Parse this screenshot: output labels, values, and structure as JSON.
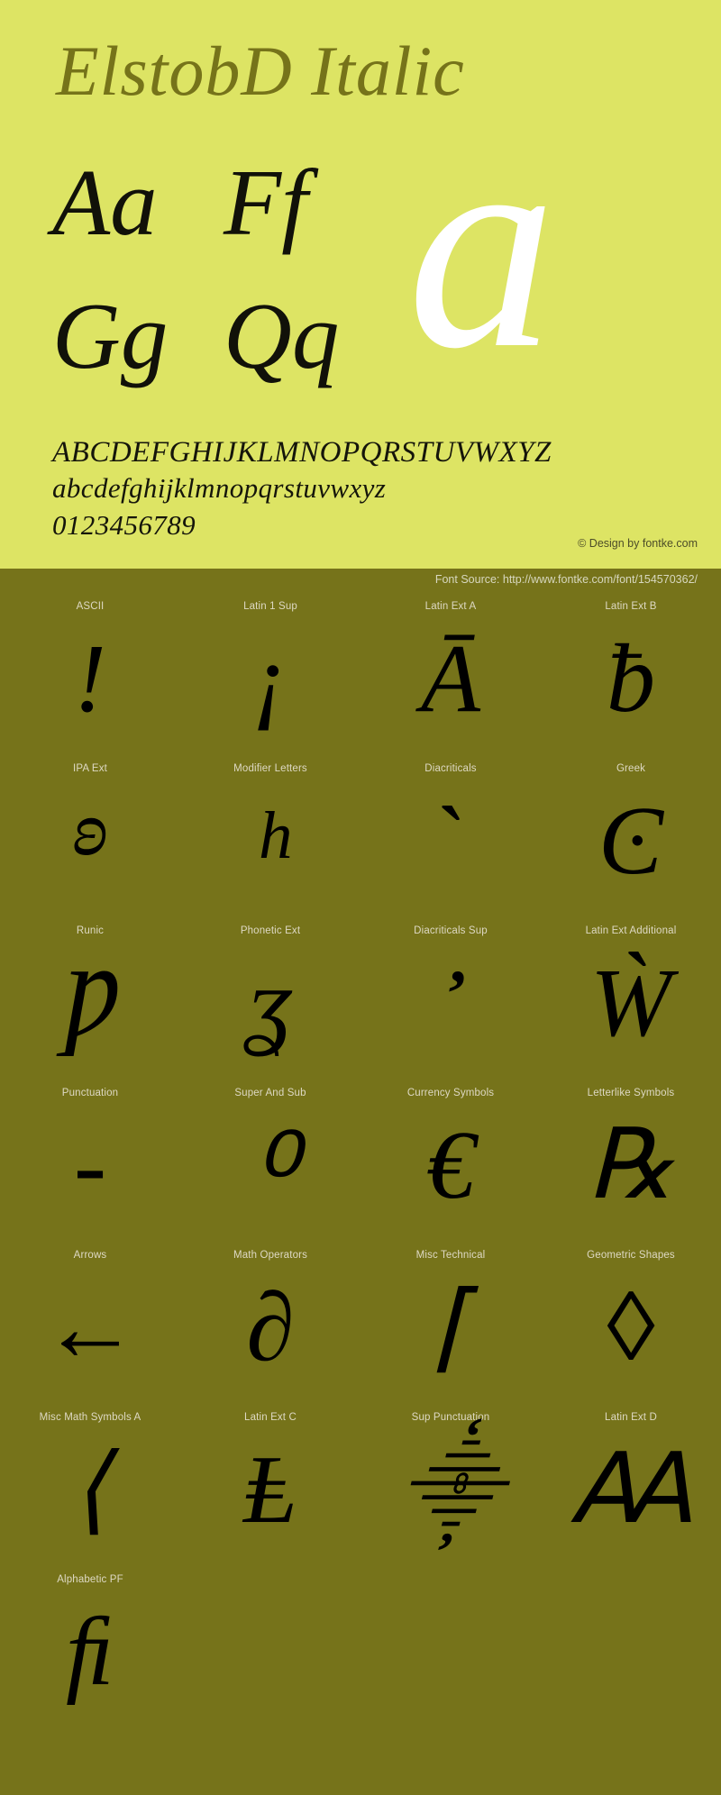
{
  "hero": {
    "title": "ElstobD Italic",
    "watermark_glyph": "a",
    "letter_pairs": [
      [
        "Aa",
        "Ff"
      ],
      [
        "Gg",
        "Qq"
      ]
    ],
    "alphabet_upper": "ABCDEFGHIJKLMNOPQRSTUVWXYZ",
    "alphabet_lower": "abcdefghijklmnopqrstuvwxyz",
    "digits": "0123456789",
    "credit": "© Design by fontke.com",
    "colors": {
      "hero_background": "#dde464",
      "title": "#76731a",
      "glyph": "#111109",
      "watermark": "#ffffff",
      "credit": "#4c4c28"
    }
  },
  "source_bar": {
    "text": "Font Source: http://www.fontke.com/font/154570362/",
    "background": "#76731a",
    "text_color": "#d8d8c0"
  },
  "glyph_grid": {
    "background": "#76731a",
    "label_color": "#ded9c4",
    "glyph_color": "#000000",
    "rows": [
      [
        {
          "label": "ASCII",
          "glyph": "!",
          "size": "md"
        },
        {
          "label": "Latin 1 Sup",
          "glyph": "¡",
          "size": "md"
        },
        {
          "label": "Latin Ext A",
          "glyph": "Ā",
          "size": "md"
        },
        {
          "label": "Latin Ext B",
          "glyph": "ƀ",
          "size": "md"
        }
      ],
      [
        {
          "label": "IPA Ext",
          "glyph": "ʚ",
          "size": "sm"
        },
        {
          "label": "Modifier Letters",
          "glyph": "ʰ",
          "size": "lg"
        },
        {
          "label": "Diacriticals",
          "glyph": "ˋ",
          "size": "md"
        },
        {
          "label": "Greek",
          "glyph": "Ͼ",
          "size": "md"
        }
      ],
      [
        {
          "label": "Runic",
          "glyph": "Ƿ",
          "size": "md"
        },
        {
          "label": "Phonetic Ext",
          "glyph": "ʓ",
          "size": "md"
        },
        {
          "label": "Diacriticals Sup",
          "glyph": "᾿",
          "size": "lg"
        },
        {
          "label": "Latin Ext Additional",
          "glyph": "Ẁ",
          "size": "md"
        }
      ],
      [
        {
          "label": "Punctuation",
          "glyph": "‐",
          "size": "md"
        },
        {
          "label": "Super And Sub",
          "glyph": "⁰",
          "size": "lg"
        },
        {
          "label": "Currency Symbols",
          "glyph": "€",
          "size": "md"
        },
        {
          "label": "Letterlike Symbols",
          "glyph": "℞",
          "size": "md"
        }
      ],
      [
        {
          "label": "Arrows",
          "glyph": "←",
          "size": "md"
        },
        {
          "label": "Math Operators",
          "glyph": "∂",
          "size": "md"
        },
        {
          "label": "Misc Technical",
          "glyph": "⌈",
          "size": "md"
        },
        {
          "label": "Geometric Shapes",
          "glyph": "◊",
          "size": "md"
        }
      ],
      [
        {
          "label": "Misc Math Symbols A",
          "glyph": "⟨",
          "size": "md"
        },
        {
          "label": "Latin Ext C",
          "glyph": "Ⱡ",
          "size": "md"
        },
        {
          "label": "Sup Punctuation",
          "glyph": "⸎",
          "size": "md"
        },
        {
          "label": "Latin Ext D",
          "glyph": "Ꜳ",
          "size": "md"
        }
      ],
      [
        {
          "label": "Alphabetic PF",
          "glyph": "ﬁ",
          "size": "md"
        }
      ]
    ]
  }
}
